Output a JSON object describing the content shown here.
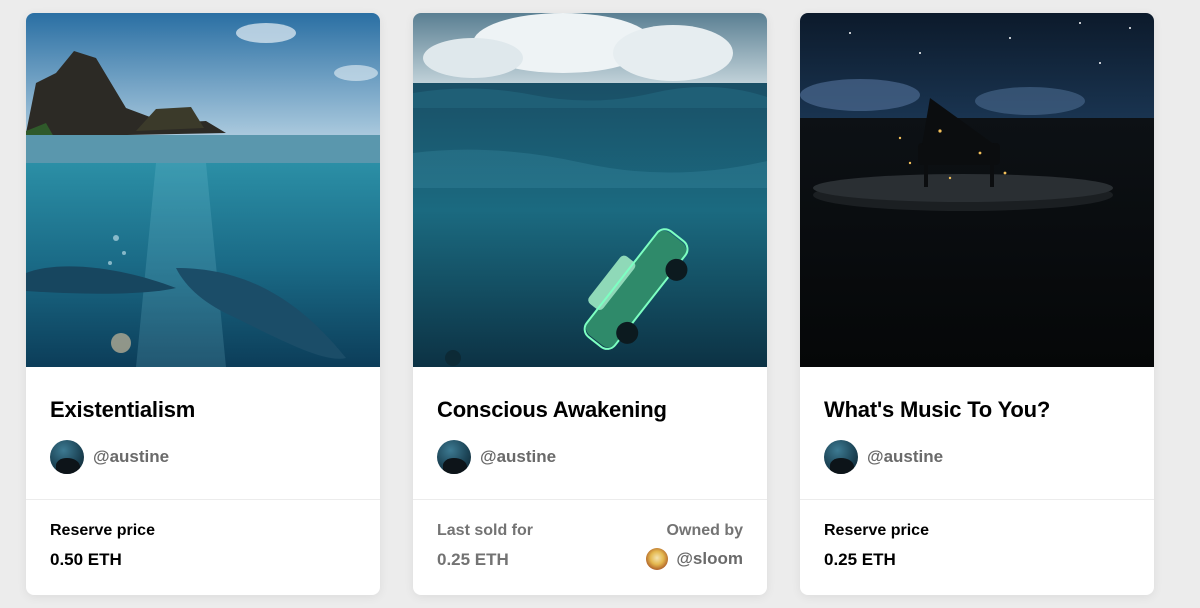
{
  "cards": [
    {
      "title": "Existentialism",
      "creator": "@austine",
      "footer": {
        "label": "Reserve price",
        "value": "0.50 ETH"
      }
    },
    {
      "title": "Conscious Awakening",
      "creator": "@austine",
      "footer": {
        "label": "Last sold for",
        "value": "0.25 ETH",
        "owned_label": "Owned by",
        "owner": "@sloom"
      }
    },
    {
      "title": "What's Music To You?",
      "creator": "@austine",
      "footer": {
        "label": "Reserve price",
        "value": "0.25 ETH"
      }
    }
  ]
}
